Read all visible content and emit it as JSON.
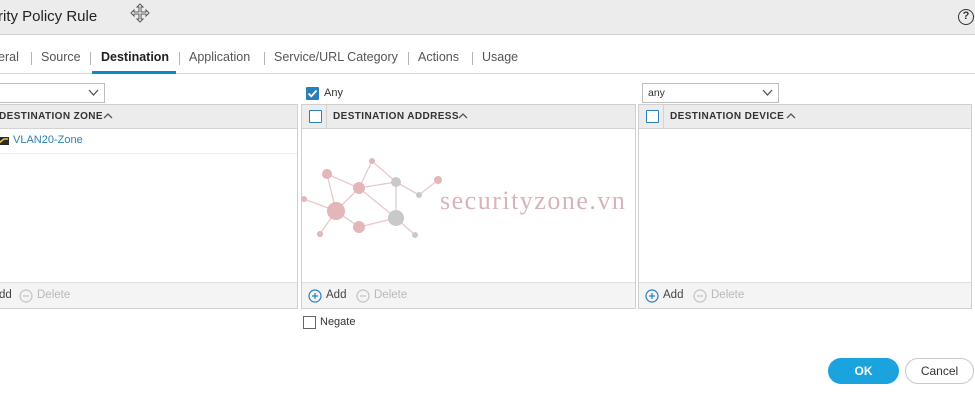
{
  "window": {
    "title": "rity Policy Rule",
    "help_glyph": "?"
  },
  "tabs": [
    {
      "label": "eral"
    },
    {
      "label": "Source"
    },
    {
      "label": "Destination",
      "active": true
    },
    {
      "label": "Application"
    },
    {
      "label": "Service/URL Category"
    },
    {
      "label": "Actions"
    },
    {
      "label": "Usage"
    }
  ],
  "zone_panel": {
    "select_value": "",
    "header": "DESTINATION ZONE",
    "rows": [
      {
        "label": "VLAN20-Zone"
      }
    ],
    "add_label": "dd",
    "delete_label": "Delete"
  },
  "address_panel": {
    "any_checked": true,
    "any_label": "Any",
    "header": "DESTINATION ADDRESS",
    "add_label": "Add",
    "delete_label": "Delete",
    "negate_label": "Negate"
  },
  "device_panel": {
    "select_value": "any",
    "header": "DESTINATION DEVICE",
    "add_label": "Add",
    "delete_label": "Delete"
  },
  "watermark": {
    "text": "securityzone.vn"
  },
  "footer": {
    "ok_label": "OK",
    "cancel_label": "Cancel"
  },
  "colors": {
    "accent": "#1aa3dd",
    "link": "#2a7fb8",
    "tab_underline": "#0a8ac4"
  }
}
